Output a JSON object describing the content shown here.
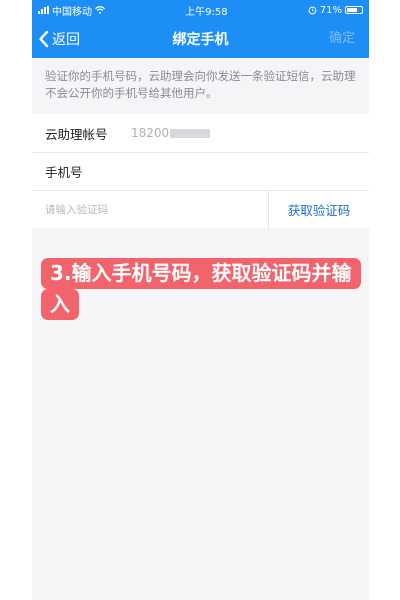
{
  "status_bar": {
    "carrier": "中国移动",
    "time": "上午9:58",
    "battery_text": "71%",
    "battery_level": 0.71
  },
  "nav": {
    "back_label": "返回",
    "title": "绑定手机",
    "confirm_label": "确定"
  },
  "description": "验证你的手机号码，云助理会向你发送一条验证短信，云助理不会公开你的手机号给其他用户。",
  "form": {
    "account_label": "云助理帐号",
    "account_value": "18200",
    "phone_label": "手机号",
    "phone_value": "",
    "code_placeholder": "请输入验证码",
    "get_code_label": "获取验证码"
  },
  "callout": {
    "text": "3.输入手机号码，获取验证码并输入"
  },
  "colors": {
    "primary": "#1e8ef7",
    "link": "#1e6fd0",
    "callout": "#f2636b",
    "background": "#f5f5f8"
  },
  "icons": [
    "signal-icon",
    "wifi-icon",
    "alarm-icon",
    "battery-icon",
    "back-chevron-icon"
  ]
}
